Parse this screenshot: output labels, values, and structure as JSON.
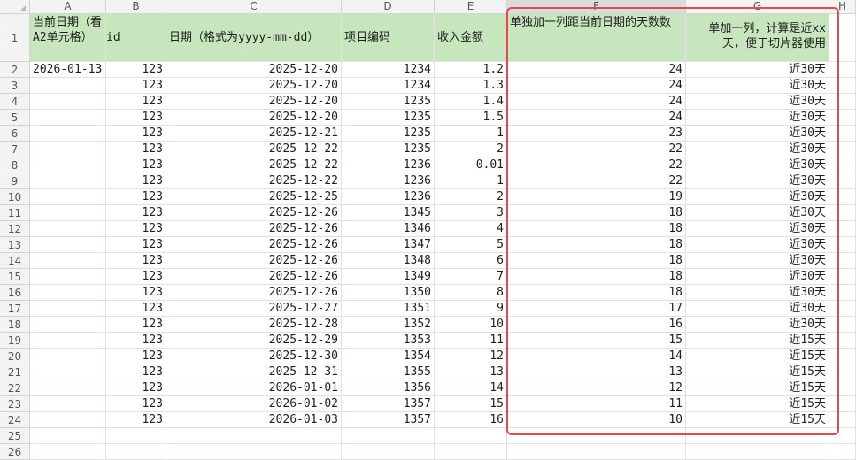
{
  "columns": [
    "A",
    "B",
    "C",
    "D",
    "E",
    "F",
    "G",
    "H"
  ],
  "row_numbers": [
    "1",
    "2",
    "3",
    "4",
    "5",
    "6",
    "7",
    "8",
    "9",
    "10",
    "11",
    "12",
    "13",
    "14",
    "15",
    "16",
    "17",
    "18",
    "19",
    "20",
    "21",
    "22",
    "23",
    "24",
    "25",
    "26"
  ],
  "header": {
    "a": "当前日期（看A2单元格）",
    "b": "id",
    "c": "日期（格式为yyyy-mm-dd）",
    "d": "项目编码",
    "e": "收入金额",
    "f": "单独加一列距当前日期的天数数",
    "g": "单加一列，计算是近xx天，便于切片器使用"
  },
  "current_date": "2026-01-13",
  "rows": [
    {
      "id": "123",
      "date": "2025-12-20",
      "code": "1234",
      "amount": "1.2",
      "days": "24",
      "bucket": "近30天"
    },
    {
      "id": "123",
      "date": "2025-12-20",
      "code": "1234",
      "amount": "1.3",
      "days": "24",
      "bucket": "近30天"
    },
    {
      "id": "123",
      "date": "2025-12-20",
      "code": "1235",
      "amount": "1.4",
      "days": "24",
      "bucket": "近30天"
    },
    {
      "id": "123",
      "date": "2025-12-20",
      "code": "1235",
      "amount": "1.5",
      "days": "24",
      "bucket": "近30天"
    },
    {
      "id": "123",
      "date": "2025-12-21",
      "code": "1235",
      "amount": "1",
      "days": "23",
      "bucket": "近30天"
    },
    {
      "id": "123",
      "date": "2025-12-22",
      "code": "1235",
      "amount": "2",
      "days": "22",
      "bucket": "近30天"
    },
    {
      "id": "123",
      "date": "2025-12-22",
      "code": "1236",
      "amount": "0.01",
      "days": "22",
      "bucket": "近30天"
    },
    {
      "id": "123",
      "date": "2025-12-22",
      "code": "1236",
      "amount": "1",
      "days": "22",
      "bucket": "近30天"
    },
    {
      "id": "123",
      "date": "2025-12-25",
      "code": "1236",
      "amount": "2",
      "days": "19",
      "bucket": "近30天"
    },
    {
      "id": "123",
      "date": "2025-12-26",
      "code": "1345",
      "amount": "3",
      "days": "18",
      "bucket": "近30天"
    },
    {
      "id": "123",
      "date": "2025-12-26",
      "code": "1346",
      "amount": "4",
      "days": "18",
      "bucket": "近30天"
    },
    {
      "id": "123",
      "date": "2025-12-26",
      "code": "1347",
      "amount": "5",
      "days": "18",
      "bucket": "近30天"
    },
    {
      "id": "123",
      "date": "2025-12-26",
      "code": "1348",
      "amount": "6",
      "days": "18",
      "bucket": "近30天"
    },
    {
      "id": "123",
      "date": "2025-12-26",
      "code": "1349",
      "amount": "7",
      "days": "18",
      "bucket": "近30天"
    },
    {
      "id": "123",
      "date": "2025-12-26",
      "code": "1350",
      "amount": "8",
      "days": "18",
      "bucket": "近30天"
    },
    {
      "id": "123",
      "date": "2025-12-27",
      "code": "1351",
      "amount": "9",
      "days": "17",
      "bucket": "近30天"
    },
    {
      "id": "123",
      "date": "2025-12-28",
      "code": "1352",
      "amount": "10",
      "days": "16",
      "bucket": "近30天"
    },
    {
      "id": "123",
      "date": "2025-12-29",
      "code": "1353",
      "amount": "11",
      "days": "15",
      "bucket": "近15天"
    },
    {
      "id": "123",
      "date": "2025-12-30",
      "code": "1354",
      "amount": "12",
      "days": "14",
      "bucket": "近15天"
    },
    {
      "id": "123",
      "date": "2025-12-31",
      "code": "1355",
      "amount": "13",
      "days": "13",
      "bucket": "近15天"
    },
    {
      "id": "123",
      "date": "2026-01-01",
      "code": "1356",
      "amount": "14",
      "days": "12",
      "bucket": "近15天"
    },
    {
      "id": "123",
      "date": "2026-01-02",
      "code": "1357",
      "amount": "15",
      "days": "11",
      "bucket": "近15天"
    },
    {
      "id": "123",
      "date": "2026-01-03",
      "code": "1357",
      "amount": "16",
      "days": "10",
      "bucket": "近15天"
    }
  ],
  "colors": {
    "header_fill": "#c7e6bd",
    "highlight_border": "#e5484d",
    "selected_column_header": "#dcdcdc"
  }
}
